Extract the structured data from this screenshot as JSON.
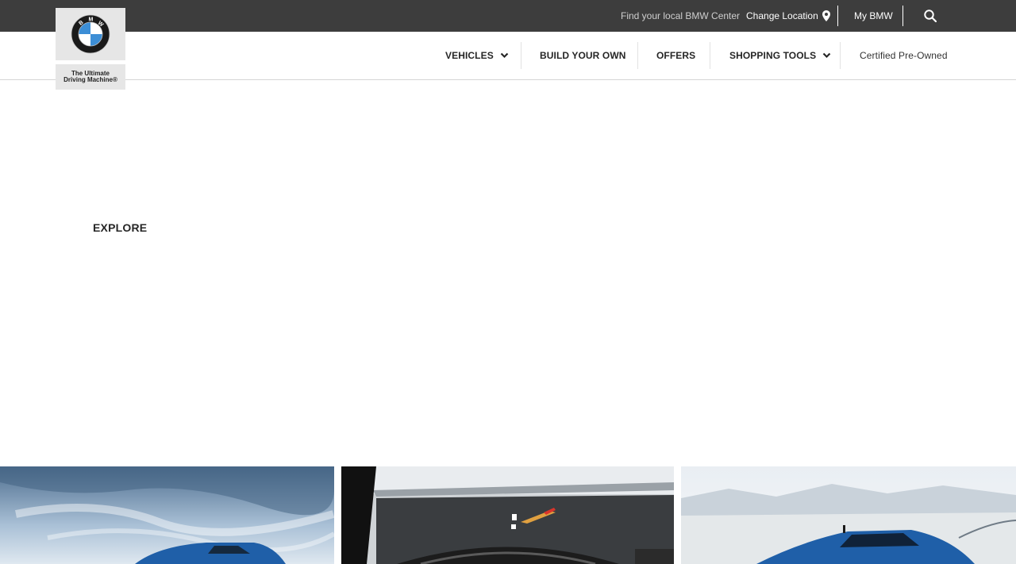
{
  "brand": {
    "logo_letters": "BMW",
    "tagline_line1": "The Ultimate",
    "tagline_line2": "Driving Machine®"
  },
  "utility_bar": {
    "find_center": "Find your local BMW Center",
    "change_location": "Change Location",
    "my_bmw": "My BMW",
    "icons": [
      "location-pin-icon",
      "search-icon"
    ]
  },
  "main_nav": {
    "items": [
      {
        "label": "VEHICLES",
        "has_dropdown": true
      },
      {
        "label": "BUILD YOUR OWN",
        "has_dropdown": false
      },
      {
        "label": "OFFERS",
        "has_dropdown": false
      },
      {
        "label": "SHOPPING TOOLS",
        "has_dropdown": true
      },
      {
        "label": "Certified Pre-Owned",
        "has_dropdown": false
      }
    ]
  },
  "content": {
    "heading": "EXPLORE",
    "tiles": [
      "blue-sedan-sky",
      "dashboard-heads-up-display",
      "blue-sedan-desert"
    ]
  },
  "colors": {
    "topbar": "#3d3d3d",
    "logo_bg": "#e6e6e6",
    "bmw_blue": "#1c69d4",
    "car_blue": "#1f5fa8"
  }
}
